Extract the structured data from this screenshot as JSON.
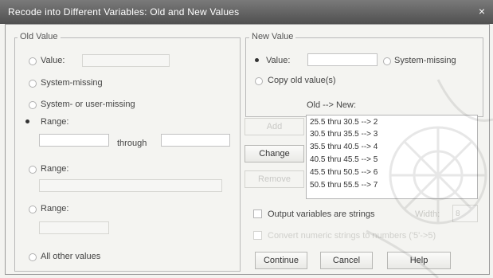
{
  "window": {
    "title": "Recode into Different Variables: Old and New Values",
    "close_glyph": "×"
  },
  "old_value": {
    "legend": "Old Value",
    "value_label": "Value:",
    "system_missing_label": "System-missing",
    "system_or_user_missing_label": "System- or user-missing",
    "range_label": "Range:",
    "range_start": "",
    "through_label": "through",
    "range_end": "",
    "range_lowest_label": "Range:",
    "range_highest_label": "Range:",
    "all_other_label": "All other values"
  },
  "new_value": {
    "legend": "New Value",
    "value_label": "Value:",
    "value_input": "",
    "system_missing_label": "System-missing",
    "copy_old_label": "Copy old value(s)"
  },
  "old_new": {
    "header": "Old --> New:",
    "items": [
      "25.5 thru 30.5 --> 2",
      "30.5 thru 35.5 --> 3",
      "35.5 thru 40.5 --> 4",
      "40.5 thru 45.5 --> 5",
      "45.5 thru 50.5 --> 6",
      "50.5 thru 55.5 --> 7"
    ],
    "add_label": "Add",
    "change_label": "Change",
    "remove_label": "Remove"
  },
  "options": {
    "output_strings_label": "Output variables are strings",
    "width_label": "Width:",
    "width_value": "8",
    "convert_label": "Convert numeric strings to numbers ('5'->5)"
  },
  "buttons": {
    "continue": "Continue",
    "cancel": "Cancel",
    "help": "Help"
  }
}
